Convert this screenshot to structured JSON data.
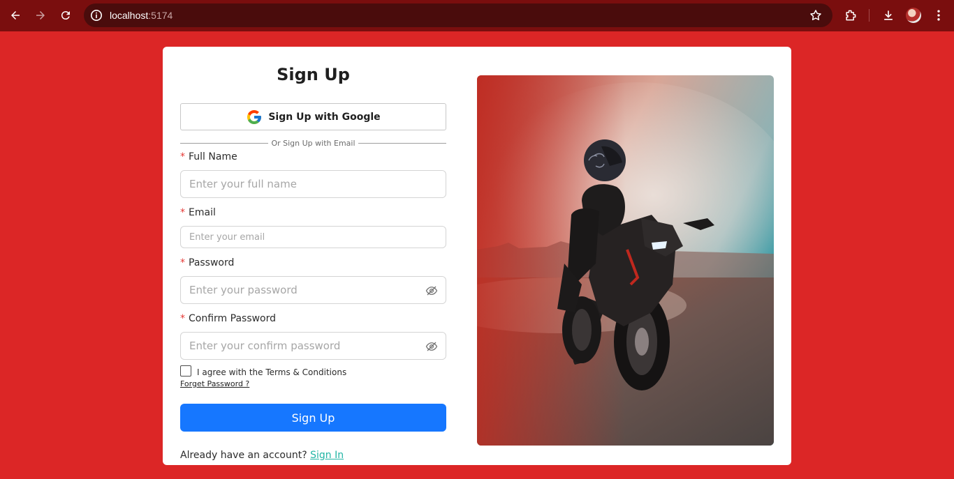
{
  "browser": {
    "url_host": "localhost",
    "url_port": ":5174"
  },
  "signup": {
    "title": "Sign Up",
    "google_button": "Sign Up with Google",
    "divider": "Or Sign Up with Email",
    "full_name_label": "Full Name",
    "full_name_placeholder": "Enter your full name",
    "email_label": "Email",
    "email_placeholder": "Enter your email",
    "password_label": "Password",
    "password_placeholder": "Enter your password",
    "confirm_label": "Confirm Password",
    "confirm_placeholder": "Enter your confirm password",
    "required_marker": "*",
    "terms_text": "I agree with the Terms & Conditions",
    "terms_checked": false,
    "forgot_link": "Forget Password ?",
    "submit_button": "Sign Up",
    "signin_prompt": "Already have an account?",
    "signin_link": "Sign In"
  },
  "colors": {
    "page_background": "#dc2626",
    "primary_button": "#1677ff",
    "link": "#22b5a5",
    "required": "#e53935"
  },
  "icons": [
    "back-icon",
    "forward-icon",
    "reload-icon",
    "info-icon",
    "star-icon",
    "extensions-icon",
    "download-icon",
    "more-icon",
    "google-icon",
    "eye-off-icon"
  ]
}
